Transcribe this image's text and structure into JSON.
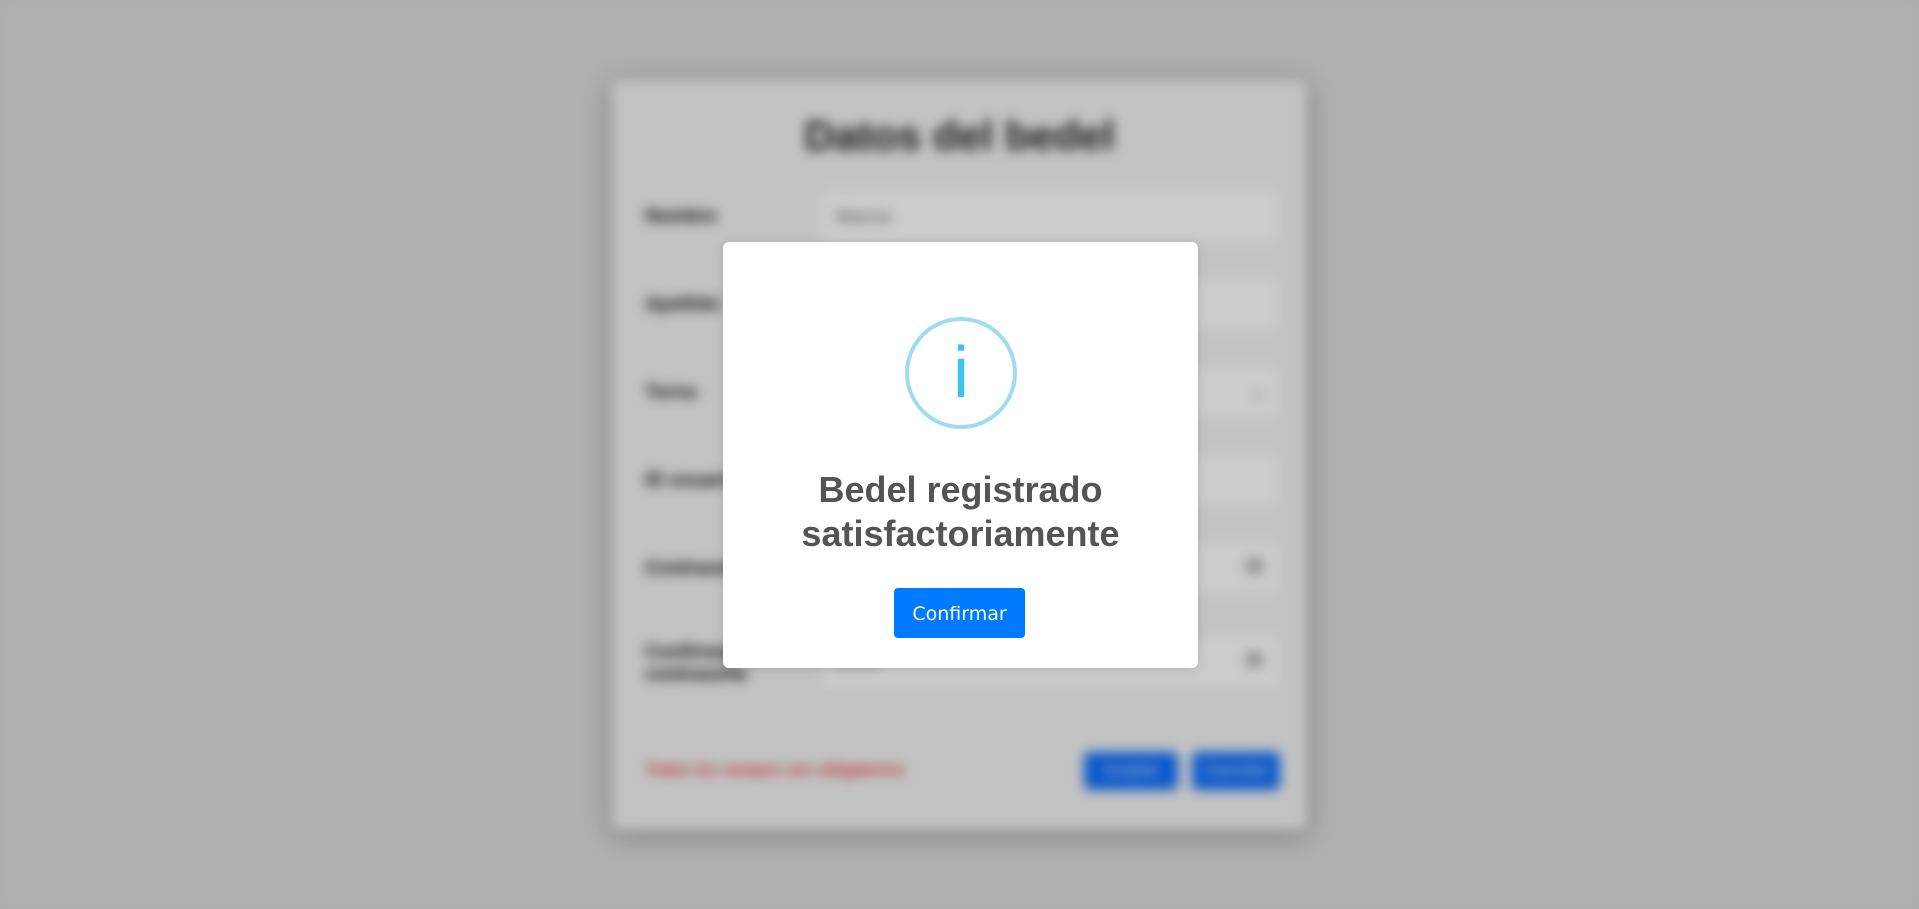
{
  "background_form": {
    "title": "Datos del bedel",
    "fields": [
      {
        "label": "Nombre",
        "value": "Marcos"
      },
      {
        "label": "Apellido",
        "value": ""
      },
      {
        "label": "Turno",
        "value": ""
      },
      {
        "label": "ID usuario",
        "value": ""
      },
      {
        "label": "Contraseña",
        "value": ""
      },
      {
        "label": "Confirmar contraseña",
        "value": "•••••••"
      }
    ],
    "error_text": "Todos los campos son obligatorios",
    "buttons": {
      "primary": "Aceptar",
      "secondary": "Cancelar"
    }
  },
  "modal": {
    "icon": "info-icon",
    "icon_glyph": "i",
    "title": "Bedel registrado satisfactoriamente",
    "confirm_label": "Confirmar"
  },
  "colors": {
    "accent": "#007bff",
    "info_ring": "#9fdcf0",
    "info_glyph": "#3fc3ee",
    "title_text": "#545454"
  }
}
